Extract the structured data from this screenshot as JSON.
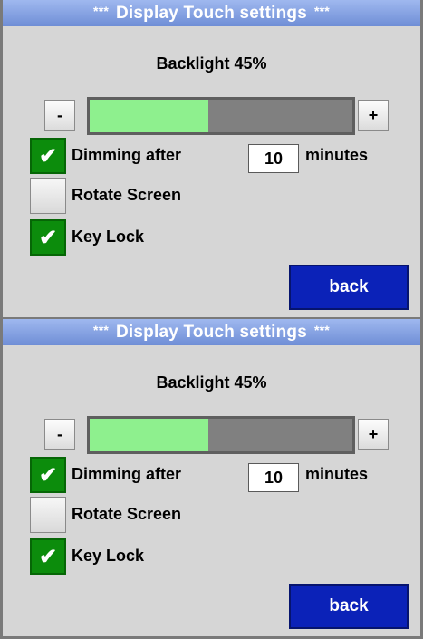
{
  "screens": [
    {
      "title": "Display Touch settings",
      "title_stars": "***",
      "backlight_label": "Backlight 45%",
      "backlight_level": 0.45,
      "minus_label": "-",
      "plus_label": "+",
      "options": [
        {
          "label": "Dimming after",
          "checked": true
        },
        {
          "label": "Rotate Screen",
          "checked": false
        },
        {
          "label": "Key Lock",
          "checked": true
        }
      ],
      "dimming_minutes": "10",
      "minutes_label": "minutes",
      "back_label": "back",
      "check_icon": "checkmark-icon"
    },
    {
      "title": "Display Touch settings",
      "title_stars": "***",
      "backlight_label": "Backlight 45%",
      "backlight_level": 0.45,
      "minus_label": "-",
      "plus_label": "+",
      "options": [
        {
          "label": "Dimming after",
          "checked": true
        },
        {
          "label": "Rotate Screen",
          "checked": false
        },
        {
          "label": "Key Lock",
          "checked": true
        }
      ],
      "dimming_minutes": "10",
      "minutes_label": "minutes",
      "back_label": "back",
      "check_icon": "checkmark-icon"
    }
  ],
  "colors": {
    "title_bar": "#8aa6e6",
    "panel_bg": "#d6d6d6",
    "slider_fill": "#8ef08e",
    "slider_track": "#808080",
    "checkbox_checked": "#0c8c0c",
    "back_button": "#0b22b8"
  }
}
